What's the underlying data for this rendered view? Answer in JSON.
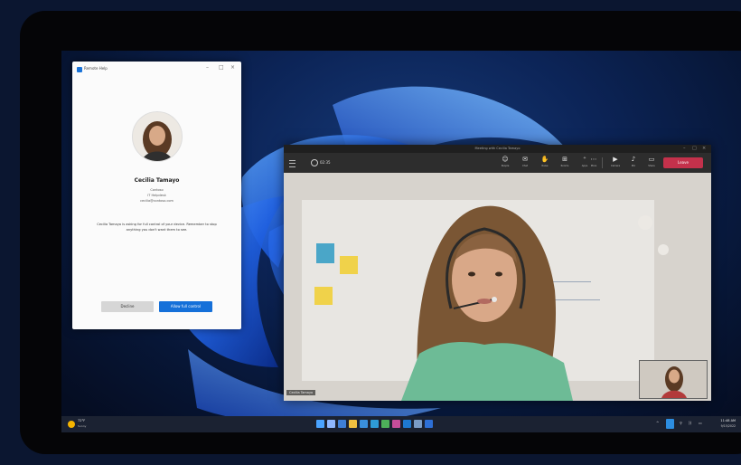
{
  "remote_dialog": {
    "title": "Remote Help",
    "contact_name": "Cecilia Tamayo",
    "contact_company": "Contoso",
    "contact_role": "IT Helpdesk",
    "contact_email": "cecilia@contoso.com",
    "message": "Cecilia Tamayo is asking for full control of your device. Remember to stop anything you don't want them to see.",
    "decline_label": "Decline",
    "allow_label": "Allow full control"
  },
  "teams": {
    "window_title": "Meeting with Cecilia Tamayo",
    "call_timer": "02:35",
    "toolbar": [
      {
        "glyph": "☺",
        "label": "People"
      },
      {
        "glyph": "✉",
        "label": "Chat"
      },
      {
        "glyph": "✋",
        "label": "Raise"
      },
      {
        "glyph": "⊞",
        "label": "Rooms"
      },
      {
        "glyph": "⁺",
        "label": "Apps"
      },
      {
        "glyph": "⋯",
        "label": "More"
      },
      {
        "glyph": "▶",
        "label": "Camera"
      },
      {
        "glyph": "♪",
        "label": "Mic"
      },
      {
        "glyph": "▭",
        "label": "Share"
      }
    ],
    "leave_label": "Leave",
    "participant_name": "Cecilia Tamayo"
  },
  "taskbar": {
    "weather_temp": "72°F",
    "weather_desc": "Sunny",
    "icon_colors": [
      "#4aa3ff",
      "#8fb8ff",
      "#3f7fd6",
      "#f0c040",
      "#3a8fdc",
      "#2e9bd6",
      "#4db05a",
      "#c54d9a",
      "#1e78d0",
      "#7a9cc6",
      "#2d6fd6"
    ],
    "tray_chevron": "^",
    "tray_icons": [
      "⚲",
      "))",
      "▭"
    ],
    "time": "11:48 AM",
    "date": "9/15/2022"
  },
  "colors": {
    "accent": "#1570d9",
    "leave": "#c4314b",
    "taskbar": "#1b2232"
  }
}
